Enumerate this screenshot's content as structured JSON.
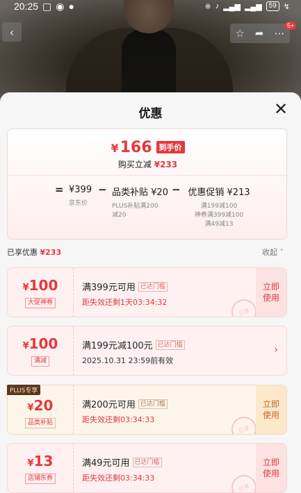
{
  "status_bar": {
    "time": "20:25",
    "left_icons": [
      "message-icon",
      "eye-icon",
      "alert-icon"
    ],
    "right_icons": [
      "bluetooth-icon",
      "mute-icon",
      "signal-icon",
      "signal-icon"
    ],
    "battery": "59"
  },
  "top_actions": {
    "back_icon": "chevron-left-icon",
    "icons": [
      "star-icon",
      "share-icon",
      "more-icon"
    ],
    "badge": "5+"
  },
  "sheet": {
    "title": "优惠",
    "summary": {
      "price_yen": "¥",
      "price_value": "166",
      "price_tag": "到手价",
      "instant_label": "购买立减",
      "instant_value": "¥233",
      "equals": "=",
      "minus": "−",
      "base_price": "¥399",
      "base_label": "京东价",
      "subsidy_label": "品类补贴",
      "subsidy_value": "¥20",
      "subsidy_note_1": "PLUS补贴满200",
      "subsidy_note_2": "减20",
      "promo_label": "优惠促销",
      "promo_value": "¥213",
      "promo_note_1": "满199减100",
      "promo_note_2": "神券满399减100",
      "promo_note_3": "满49减13"
    },
    "enjoyed_label": "已享优惠",
    "enjoyed_value": "¥233",
    "collapse_label": "收起",
    "collapse_icon": "chevron-up-icon",
    "coupons": [
      {
        "yen": "¥",
        "amount": "100",
        "tag": "大促神券",
        "condition": "满399元可用",
        "gate": "已达门槛",
        "subtitle": "距失效还剩1天03:34:32",
        "use_label_1": "立即",
        "use_label_2": "使用",
        "stamp": "已享"
      },
      {
        "yen": "¥",
        "amount": "100",
        "tag": "满减",
        "condition": "满199元减100元",
        "gate": "已达门槛",
        "subtitle": "2025.10.31 23:59前有效",
        "arrow": "›"
      },
      {
        "plus_label": "PLUS专享",
        "yen": "¥",
        "amount": "20",
        "tag": "品类补贴",
        "condition": "满200元可用",
        "gate": "已达门槛",
        "subtitle": "距失效还剩03:34:33",
        "use_label_1": "立即",
        "use_label_2": "使用",
        "stamp": "已享"
      },
      {
        "yen": "¥",
        "amount": "13",
        "tag": "店铺东券",
        "condition": "满49元可用",
        "gate": "已达门槛",
        "subtitle": "距失效还剩03:34:33",
        "use_label_1": "立即",
        "use_label_2": "使用",
        "stamp": "已享"
      }
    ]
  }
}
